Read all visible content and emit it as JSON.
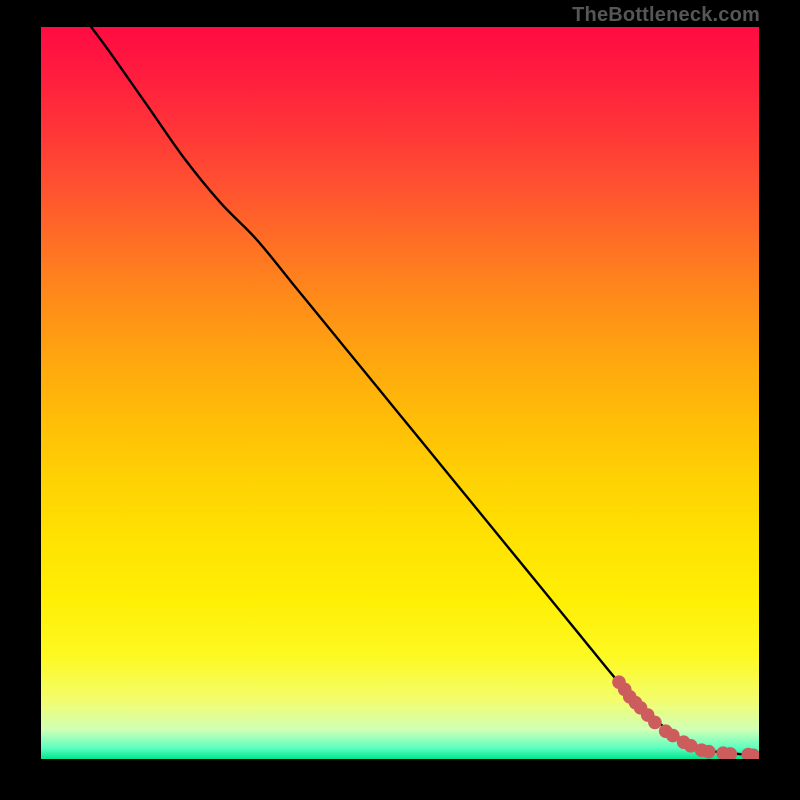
{
  "attribution": "TheBottleneck.com",
  "chart_data": {
    "type": "line",
    "title": "",
    "xlabel": "",
    "ylabel": "",
    "xlim": [
      0,
      100
    ],
    "ylim": [
      0,
      100
    ],
    "grid": false,
    "legend": false,
    "series": [
      {
        "name": "curve",
        "x": [
          7,
          10,
          15,
          20,
          25,
          30,
          35,
          40,
          45,
          50,
          55,
          60,
          65,
          70,
          75,
          80,
          82,
          84,
          86,
          88,
          90,
          92,
          94,
          96,
          98,
          99
        ],
        "values": [
          100,
          96,
          89,
          82,
          76,
          71,
          65,
          59,
          53,
          47,
          41,
          35,
          29,
          23,
          17,
          11,
          9,
          7,
          5,
          3.5,
          2.3,
          1.5,
          1.0,
          0.8,
          0.6,
          0.5
        ],
        "color": "#000000"
      },
      {
        "name": "markers",
        "type": "scatter",
        "x": [
          80.5,
          81.3,
          82.0,
          82.8,
          83.5,
          84.5,
          85.5,
          87.0,
          88.0,
          89.5,
          90.5,
          92.0,
          93.0,
          95.0,
          96.0,
          98.5,
          99.2
        ],
        "values": [
          10.5,
          9.5,
          8.5,
          7.7,
          7.0,
          6.0,
          5.0,
          3.8,
          3.2,
          2.3,
          1.8,
          1.2,
          1.0,
          0.8,
          0.7,
          0.6,
          0.5
        ],
        "color": "#cd5c5c"
      }
    ]
  },
  "colors": {
    "background_frame": "#000000",
    "attribution_text": "#565656",
    "curve": "#000000",
    "marker": "#cd5c5c"
  }
}
